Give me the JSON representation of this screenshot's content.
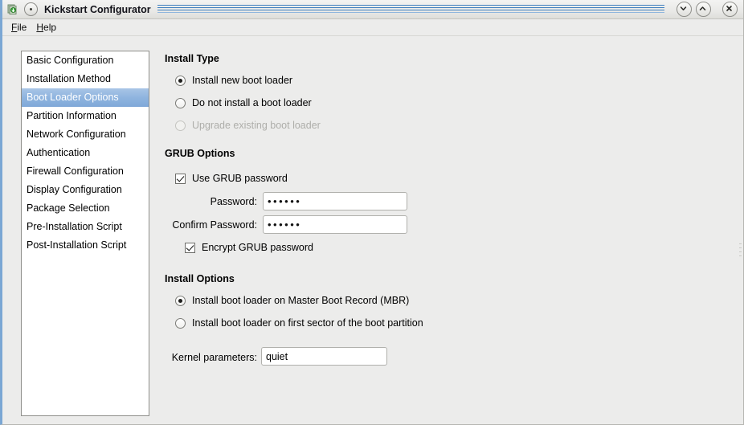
{
  "window": {
    "title": "Kickstart Configurator",
    "app_icon": "kickstart-icon",
    "shade_button": "window-menu-icon",
    "controls": [
      {
        "name": "minimize",
        "icon": "chevron-down-icon"
      },
      {
        "name": "maximize",
        "icon": "chevron-up-icon"
      },
      {
        "name": "close",
        "icon": "close-x-icon"
      }
    ]
  },
  "menubar": {
    "items": [
      {
        "label": "File",
        "mnemonic": "F",
        "rest": "ile"
      },
      {
        "label": "Help",
        "mnemonic": "H",
        "rest": "elp"
      }
    ]
  },
  "sidebar": {
    "selected_index": 2,
    "items": [
      {
        "label": "Basic Configuration"
      },
      {
        "label": "Installation Method"
      },
      {
        "label": "Boot Loader Options"
      },
      {
        "label": "Partition Information"
      },
      {
        "label": "Network Configuration"
      },
      {
        "label": "Authentication"
      },
      {
        "label": "Firewall Configuration"
      },
      {
        "label": "Display Configuration"
      },
      {
        "label": "Package Selection"
      },
      {
        "label": "Pre-Installation Script"
      },
      {
        "label": "Post-Installation Script"
      }
    ]
  },
  "install_type": {
    "title": "Install Type",
    "options": [
      {
        "label": "Install new boot loader",
        "checked": true,
        "disabled": false
      },
      {
        "label": "Do not install a boot loader",
        "checked": false,
        "disabled": false
      },
      {
        "label": "Upgrade existing boot loader",
        "checked": false,
        "disabled": true
      }
    ]
  },
  "grub_options": {
    "title": "GRUB Options",
    "use_password": {
      "label": "Use GRUB password",
      "checked": true
    },
    "password": {
      "label": "Password:",
      "value": "••••••"
    },
    "confirm_password": {
      "label": "Confirm Password:",
      "value": "••••••"
    },
    "encrypt": {
      "label": "Encrypt GRUB password",
      "checked": true
    }
  },
  "install_options": {
    "title": "Install Options",
    "options": [
      {
        "label": "Install boot loader on Master Boot Record (MBR)",
        "checked": true
      },
      {
        "label": "Install boot loader on first sector of the boot partition",
        "checked": false
      }
    ],
    "kernel_parameters": {
      "label": "Kernel parameters:",
      "value": "quiet"
    }
  },
  "colors": {
    "selection": "#8fb4df",
    "title_stripe": "#3f7fbf",
    "window_bg": "#ececeb",
    "field_bg": "#ffffff"
  }
}
